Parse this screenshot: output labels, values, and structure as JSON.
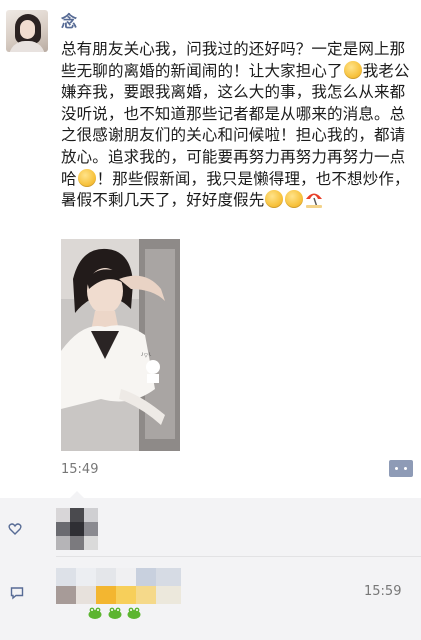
{
  "post": {
    "author": "念",
    "text_parts": [
      "总有朋友关心我，问我过的还好吗？一定是网上那些无聊的离婚的新闻闹的！让大家担心了",
      "我老公嫌弃我，要跟我离婚，这么大的事，我怎么从来都没听说，也不知道那些记者都是从哪来的消息。总之很感谢朋友们的关心和问候啦！担心我的，都请放心。追求我的，可能要再努力再努力再努力一点哈",
      "！那些假新闻，我只是懒得理，也不想炒作，暑假不剩几天了，好好度假先"
    ],
    "emojis": [
      "relieved-face-emoji",
      "thinking-face-emoji",
      "grimace-face-emoji",
      "grimace-face-emoji",
      "beach-umbrella-emoji"
    ],
    "photo_icon": "selfie-photo",
    "time": "15:49"
  },
  "comment_section": {
    "like_icon": "heart-icon",
    "comment_icon": "comment-icon",
    "comment_time": "15:59"
  },
  "colors": {
    "name_link": "#576b95",
    "comment_bg": "#f3f3f5",
    "more_button": "#8e9bb6"
  }
}
